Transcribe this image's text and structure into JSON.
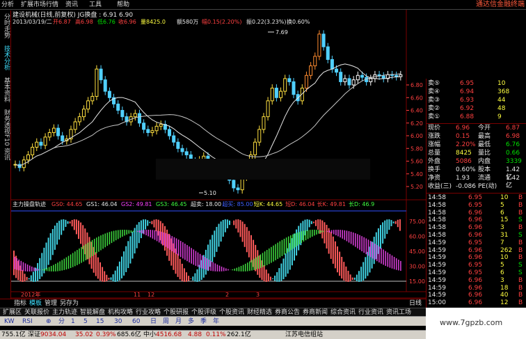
{
  "menubar": {
    "items": [
      "分析",
      "扩展市场行情",
      "资讯",
      "工具",
      "帮助"
    ],
    "brand": "通达信金融终端"
  },
  "left_tabs": [
    "分时走势",
    "技术分析",
    "基本资料",
    "财务透视",
    "F10 资讯"
  ],
  "kline": {
    "title": "建设机械(日线,前复权) JG换盘 : 6.91   6.90",
    "info": {
      "date": "2013/03/19/二",
      "open": "开6.87",
      "high": "高6.98",
      "low": "低6.76",
      "close": "收6.96",
      "volume": "量8425.0",
      "amount": "额580万",
      "change": "幅0.15(2.20%)",
      "amplitude": "振0.22(3.23%)",
      "turnover": "换0.60%"
    },
    "y_labels": [
      "6.80",
      "6.60",
      "6.40",
      "6.20",
      "6.00",
      "5.80",
      "5.60",
      "5.40",
      "5.20"
    ],
    "high_label": "7.69",
    "low_label": "5.10"
  },
  "indicator": {
    "name": "主力操盘轨迹",
    "values": [
      {
        "label": "GS0: 44.65",
        "color": "#ff4040"
      },
      {
        "label": "GS1: 46.04",
        "color": "#e8e8e8"
      },
      {
        "label": "GS2: 49.81",
        "color": "#ff40ff"
      },
      {
        "label": "GS3: 46.45",
        "color": "#40ff40"
      },
      {
        "label": "超卖: 18.00",
        "color": "#e8e8e8"
      },
      {
        "label": "超买: 85.00",
        "color": "#4060ff"
      },
      {
        "label": "短K: 44.65",
        "color": "#ffff40"
      },
      {
        "label": "短D: 46.04",
        "color": "#ff4040"
      },
      {
        "label": "长K: 49.81",
        "color": "#ff4040"
      },
      {
        "label": "长D: 46.9",
        "color": "#40ff40"
      }
    ],
    "y_labels": [
      "75.00",
      "60.00",
      "45.00",
      "30.00",
      "15.00"
    ]
  },
  "x_axis": [
    "2012年",
    "11",
    "12",
    "2",
    "3"
  ],
  "quote": {
    "asks": [
      {
        "label": "卖⑤",
        "price": "6.95",
        "vol": "10"
      },
      {
        "label": "卖④",
        "price": "6.94",
        "vol": "368"
      },
      {
        "label": "卖③",
        "price": "6.93",
        "vol": "44"
      },
      {
        "label": "卖②",
        "price": "6.92",
        "vol": "48"
      },
      {
        "label": "卖①",
        "price": "6.88",
        "vol": "9"
      }
    ],
    "stats": [
      {
        "l1": "现价",
        "v1": "6.96",
        "l2": "今开",
        "v2": "6.87",
        "c1": "red",
        "c2": "red"
      },
      {
        "l1": "涨跌",
        "v1": "0.15",
        "l2": "最高",
        "v2": "6.98",
        "c1": "red",
        "c2": "red"
      },
      {
        "l1": "涨幅",
        "v1": "2.20%",
        "l2": "最低",
        "v2": "6.76",
        "c1": "red",
        "c2": "grn"
      },
      {
        "l1": "总量",
        "v1": "8425",
        "l2": "量比",
        "v2": "0.66",
        "c1": "yel",
        "c2": "grn"
      },
      {
        "l1": "外盘",
        "v1": "5086",
        "l2": "内盘",
        "v2": "3339",
        "c1": "red",
        "c2": "grn"
      },
      {
        "l1": "换手",
        "v1": "0.60%",
        "l2": "股本",
        "v2": "1.42亿",
        "c1": "wht",
        "c2": "wht"
      },
      {
        "l1": "净资",
        "v1": "1.93",
        "l2": "流通",
        "v2": "1.42亿",
        "c1": "wht",
        "c2": "wht"
      },
      {
        "l1": "收益(三)",
        "v1": "-0.086",
        "l2": "PE(动)",
        "v2": "-",
        "c1": "wht",
        "c2": "wht"
      }
    ],
    "ticks": [
      {
        "t": "14:58",
        "p": "6.95",
        "v": "10",
        "d": "B"
      },
      {
        "t": "14:58",
        "p": "6.95",
        "v": "5",
        "d": "B"
      },
      {
        "t": "14:58",
        "p": "6.96",
        "v": "6",
        "d": "B"
      },
      {
        "t": "14:58",
        "p": "6.96",
        "v": "15",
        "d": "S"
      },
      {
        "t": "14:58",
        "p": "6.96",
        "v": "3",
        "d": "B"
      },
      {
        "t": "14:58",
        "p": "6.96",
        "v": "31",
        "d": "S"
      },
      {
        "t": "14:59",
        "p": "6.95",
        "v": "7",
        "d": "B"
      },
      {
        "t": "14:59",
        "p": "6.96",
        "v": "262",
        "d": "B"
      },
      {
        "t": "14:59",
        "p": "6.96",
        "v": "10",
        "d": "B"
      },
      {
        "t": "14:59",
        "p": "6.95",
        "v": "5",
        "d": "S"
      },
      {
        "t": "14:59",
        "p": "6.95",
        "v": "6",
        "d": "S"
      },
      {
        "t": "14:59",
        "p": "6.96",
        "v": "3",
        "d": "B"
      },
      {
        "t": "14:59",
        "p": "6.96",
        "v": "18",
        "d": "B"
      },
      {
        "t": "14:59",
        "p": "6.96",
        "v": "40",
        "d": "B"
      },
      {
        "t": "15:00",
        "p": "6.96",
        "v": "12",
        "d": "B"
      }
    ]
  },
  "bottom_tabs": [
    "指标",
    "模板",
    "管理",
    "另存为"
  ],
  "function_tabs": [
    "扩展区",
    "关联报价",
    "主力轨迹",
    "智能解盘",
    "机构攻略",
    "行业攻略",
    "个股研报",
    "个股评级",
    "个股资讯",
    "财经精选",
    "券商公告",
    "券商新闻",
    "综合资讯",
    "行业资讯",
    "资讯工场"
  ],
  "toolbar": [
    "KW",
    "RSI",
    "⊕",
    "分",
    "1",
    "5",
    "15",
    "30",
    "60",
    "日",
    "周",
    "月",
    "多",
    "季",
    "年"
  ],
  "status": {
    "sh": "755.1亿",
    "sz_label": "深证",
    "sz_val": "9034.04",
    "sz_chg": "35.02",
    "sz_pct": "0.39%",
    "sz_amt": "685.6亿",
    "zx_label": "中小",
    "zx_val": "4516.68",
    "zx_chg": "4.88",
    "zx_pct": "0.11%",
    "zx_amt": "262.1亿",
    "site": "江苏电信组站"
  },
  "watermark": "www.7gpzb.com"
}
